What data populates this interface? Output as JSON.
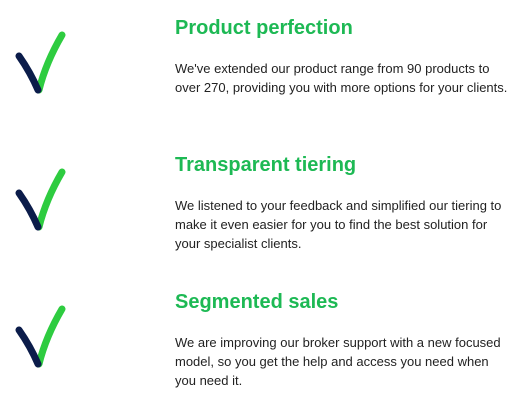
{
  "colors": {
    "title_green": "#1DB954",
    "check_green": "#2ECC40",
    "check_navy": "#0B1C4A",
    "body_text": "#222222"
  },
  "features": [
    {
      "icon": "checkmark-icon",
      "title": "Product perfection",
      "description": "We've extended our product range from 90 products to over 270, providing you with more options for your clients."
    },
    {
      "icon": "checkmark-icon",
      "title": "Transparent tiering",
      "description": "We listened to your feedback and simplified our tiering to make it even easier for you to find the best solution for your specialist clients."
    },
    {
      "icon": "checkmark-icon",
      "title": "Segmented sales",
      "description": "We are improving our broker support with a new focused model, so you get the help and access you need when you need it."
    }
  ]
}
